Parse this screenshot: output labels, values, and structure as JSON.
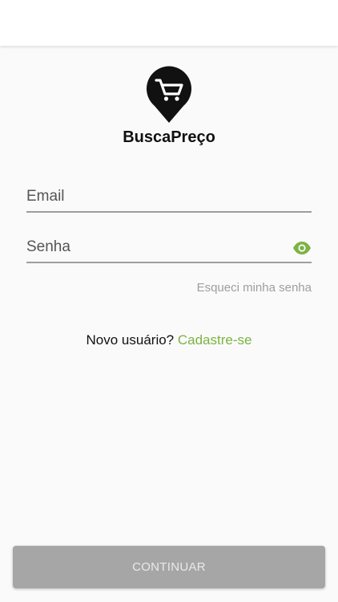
{
  "app": {
    "name": "BuscaPreço",
    "logo_icon": "shopping-cart-pin-icon"
  },
  "form": {
    "email_placeholder": "Email",
    "password_placeholder": "Senha",
    "password_toggle_icon": "eye-icon",
    "forgot_password_label": "Esqueci minha senha"
  },
  "signup": {
    "prompt": "Novo usuário?",
    "link_label": "Cadastre-se"
  },
  "actions": {
    "continue_label": "CONTINUAR"
  },
  "colors": {
    "accent": "#7cb342",
    "button_disabled": "#a6a6a6",
    "underline": "#9e9e9e"
  }
}
